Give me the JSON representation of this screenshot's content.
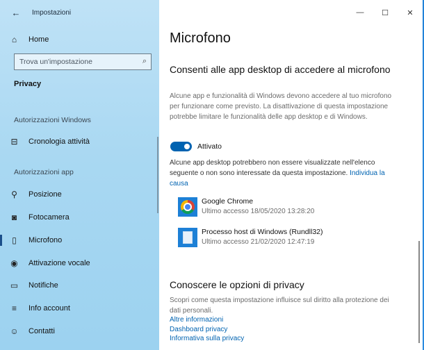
{
  "window": {
    "title": "Impostazioni",
    "controls": {
      "minimize": "—",
      "maximize": "☐",
      "close": "✕"
    }
  },
  "sidebar": {
    "back_glyph": "←",
    "home": {
      "label": "Home",
      "icon": "home-icon"
    },
    "search": {
      "placeholder": "Trova un'impostazione",
      "icon": "search-icon"
    },
    "category": "Privacy",
    "section_windows": "Autorizzazioni Windows",
    "activity": {
      "label": "Cronologia attività",
      "icon": "timeline-icon"
    },
    "section_apps": "Autorizzazioni app",
    "items": [
      {
        "label": "Posizione",
        "icon": "location-icon"
      },
      {
        "label": "Fotocamera",
        "icon": "camera-icon"
      },
      {
        "label": "Microfono",
        "icon": "microphone-icon",
        "active": true
      },
      {
        "label": "Attivazione vocale",
        "icon": "voice-activation-icon"
      },
      {
        "label": "Notifiche",
        "icon": "notifications-icon"
      },
      {
        "label": "Info account",
        "icon": "account-info-icon"
      },
      {
        "label": "Contatti",
        "icon": "contacts-icon"
      }
    ]
  },
  "main": {
    "title": "Microfono",
    "section1": {
      "heading": "Consenti alle app desktop di accedere al microfono",
      "description": "Alcune app e funzionalità di Windows devono accedere al tuo microfono per funzionare come previsto. La disattivazione di questa impostazione potrebbe limitare le funzionalità delle app desktop e di Windows.",
      "toggle_state": "Attivato",
      "note": "Alcune app desktop potrebbero non essere visualizzate nell'elenco seguente o non sono interessate da questa impostazione.",
      "note_link": "Individua la causa"
    },
    "apps": [
      {
        "name": "Google Chrome",
        "last_access": "Ultimo accesso 18/05/2020 13:28:20",
        "icon": "chrome-icon"
      },
      {
        "name": "Processo host di Windows (Rundll32)",
        "last_access": "Ultimo accesso 21/02/2020 12:47:19",
        "icon": "document-icon"
      }
    ],
    "section2": {
      "heading": "Conoscere le opzioni di privacy",
      "description": "Scopri come questa impostazione influisce sul diritto alla protezione dei dati personali.",
      "links": [
        "Altre informazioni",
        "Dashboard privacy",
        "Informativa sulla privacy"
      ]
    }
  },
  "colors": {
    "accent": "#0063b1",
    "sidebar_bg": "#a9d8f2"
  }
}
